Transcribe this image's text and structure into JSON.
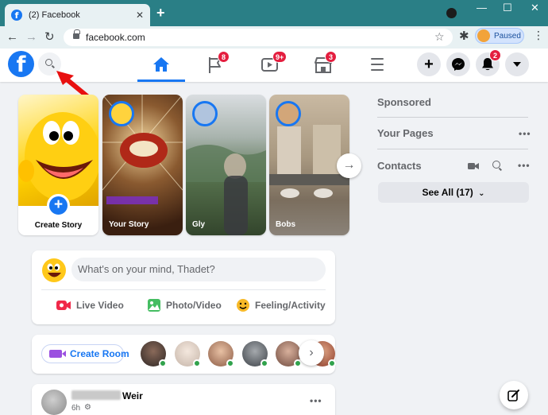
{
  "browser": {
    "tab_title": "(2) Facebook",
    "tab_close": "✕",
    "new_tab": "+",
    "url": "facebook.com",
    "profile_status": "Paused",
    "min": "—",
    "max": "☐",
    "close": "✕"
  },
  "header": {
    "logo_letter": "f",
    "nav_badges": {
      "flag": "8",
      "watch": "9+",
      "market": "3"
    },
    "notifications_badge": "2"
  },
  "stories": {
    "create_label": "Create Story",
    "items": [
      {
        "name": "Your Story",
        "bg": "#5a3520"
      },
      {
        "name": "Gly",
        "bg": "#6f8a6a"
      },
      {
        "name": "Bobs",
        "bg": "#8b7f6e"
      }
    ],
    "next": "→"
  },
  "composer": {
    "placeholder": "What's on your mind, Thadet?",
    "live_video": "Live Video",
    "photo_video": "Photo/Video",
    "feeling": "Feeling/Activity"
  },
  "rooms": {
    "create_room": "Create Room",
    "next": "›"
  },
  "post": {
    "author_suffix": "Weir",
    "time": "6h",
    "menu": "•••"
  },
  "right": {
    "sponsored": "Sponsored",
    "your_pages": "Your Pages",
    "contacts": "Contacts",
    "see_all": "See All (17)",
    "dots": "•••"
  },
  "colors": {
    "fb_blue": "#1877f2",
    "badge_red": "#e41e3f",
    "chrome_teal": "#2a7f86"
  }
}
